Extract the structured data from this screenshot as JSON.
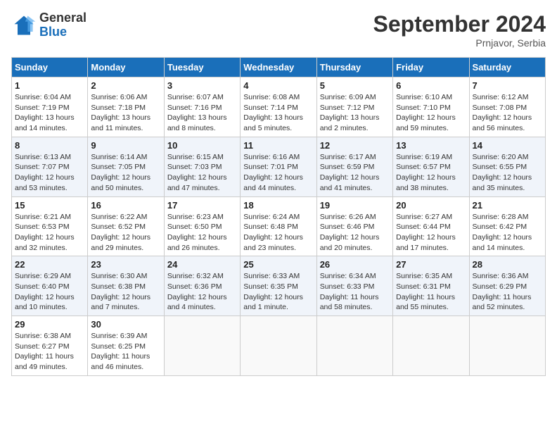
{
  "header": {
    "logo_general": "General",
    "logo_blue": "Blue",
    "month_title": "September 2024",
    "location": "Prnjavor, Serbia"
  },
  "weekdays": [
    "Sunday",
    "Monday",
    "Tuesday",
    "Wednesday",
    "Thursday",
    "Friday",
    "Saturday"
  ],
  "weeks": [
    [
      {
        "day": "1",
        "info": "Sunrise: 6:04 AM\nSunset: 7:19 PM\nDaylight: 13 hours and 14 minutes."
      },
      {
        "day": "2",
        "info": "Sunrise: 6:06 AM\nSunset: 7:18 PM\nDaylight: 13 hours and 11 minutes."
      },
      {
        "day": "3",
        "info": "Sunrise: 6:07 AM\nSunset: 7:16 PM\nDaylight: 13 hours and 8 minutes."
      },
      {
        "day": "4",
        "info": "Sunrise: 6:08 AM\nSunset: 7:14 PM\nDaylight: 13 hours and 5 minutes."
      },
      {
        "day": "5",
        "info": "Sunrise: 6:09 AM\nSunset: 7:12 PM\nDaylight: 13 hours and 2 minutes."
      },
      {
        "day": "6",
        "info": "Sunrise: 6:10 AM\nSunset: 7:10 PM\nDaylight: 12 hours and 59 minutes."
      },
      {
        "day": "7",
        "info": "Sunrise: 6:12 AM\nSunset: 7:08 PM\nDaylight: 12 hours and 56 minutes."
      }
    ],
    [
      {
        "day": "8",
        "info": "Sunrise: 6:13 AM\nSunset: 7:07 PM\nDaylight: 12 hours and 53 minutes."
      },
      {
        "day": "9",
        "info": "Sunrise: 6:14 AM\nSunset: 7:05 PM\nDaylight: 12 hours and 50 minutes."
      },
      {
        "day": "10",
        "info": "Sunrise: 6:15 AM\nSunset: 7:03 PM\nDaylight: 12 hours and 47 minutes."
      },
      {
        "day": "11",
        "info": "Sunrise: 6:16 AM\nSunset: 7:01 PM\nDaylight: 12 hours and 44 minutes."
      },
      {
        "day": "12",
        "info": "Sunrise: 6:17 AM\nSunset: 6:59 PM\nDaylight: 12 hours and 41 minutes."
      },
      {
        "day": "13",
        "info": "Sunrise: 6:19 AM\nSunset: 6:57 PM\nDaylight: 12 hours and 38 minutes."
      },
      {
        "day": "14",
        "info": "Sunrise: 6:20 AM\nSunset: 6:55 PM\nDaylight: 12 hours and 35 minutes."
      }
    ],
    [
      {
        "day": "15",
        "info": "Sunrise: 6:21 AM\nSunset: 6:53 PM\nDaylight: 12 hours and 32 minutes."
      },
      {
        "day": "16",
        "info": "Sunrise: 6:22 AM\nSunset: 6:52 PM\nDaylight: 12 hours and 29 minutes."
      },
      {
        "day": "17",
        "info": "Sunrise: 6:23 AM\nSunset: 6:50 PM\nDaylight: 12 hours and 26 minutes."
      },
      {
        "day": "18",
        "info": "Sunrise: 6:24 AM\nSunset: 6:48 PM\nDaylight: 12 hours and 23 minutes."
      },
      {
        "day": "19",
        "info": "Sunrise: 6:26 AM\nSunset: 6:46 PM\nDaylight: 12 hours and 20 minutes."
      },
      {
        "day": "20",
        "info": "Sunrise: 6:27 AM\nSunset: 6:44 PM\nDaylight: 12 hours and 17 minutes."
      },
      {
        "day": "21",
        "info": "Sunrise: 6:28 AM\nSunset: 6:42 PM\nDaylight: 12 hours and 14 minutes."
      }
    ],
    [
      {
        "day": "22",
        "info": "Sunrise: 6:29 AM\nSunset: 6:40 PM\nDaylight: 12 hours and 10 minutes."
      },
      {
        "day": "23",
        "info": "Sunrise: 6:30 AM\nSunset: 6:38 PM\nDaylight: 12 hours and 7 minutes."
      },
      {
        "day": "24",
        "info": "Sunrise: 6:32 AM\nSunset: 6:36 PM\nDaylight: 12 hours and 4 minutes."
      },
      {
        "day": "25",
        "info": "Sunrise: 6:33 AM\nSunset: 6:35 PM\nDaylight: 12 hours and 1 minute."
      },
      {
        "day": "26",
        "info": "Sunrise: 6:34 AM\nSunset: 6:33 PM\nDaylight: 11 hours and 58 minutes."
      },
      {
        "day": "27",
        "info": "Sunrise: 6:35 AM\nSunset: 6:31 PM\nDaylight: 11 hours and 55 minutes."
      },
      {
        "day": "28",
        "info": "Sunrise: 6:36 AM\nSunset: 6:29 PM\nDaylight: 11 hours and 52 minutes."
      }
    ],
    [
      {
        "day": "29",
        "info": "Sunrise: 6:38 AM\nSunset: 6:27 PM\nDaylight: 11 hours and 49 minutes."
      },
      {
        "day": "30",
        "info": "Sunrise: 6:39 AM\nSunset: 6:25 PM\nDaylight: 11 hours and 46 minutes."
      },
      {
        "day": "",
        "info": ""
      },
      {
        "day": "",
        "info": ""
      },
      {
        "day": "",
        "info": ""
      },
      {
        "day": "",
        "info": ""
      },
      {
        "day": "",
        "info": ""
      }
    ]
  ]
}
